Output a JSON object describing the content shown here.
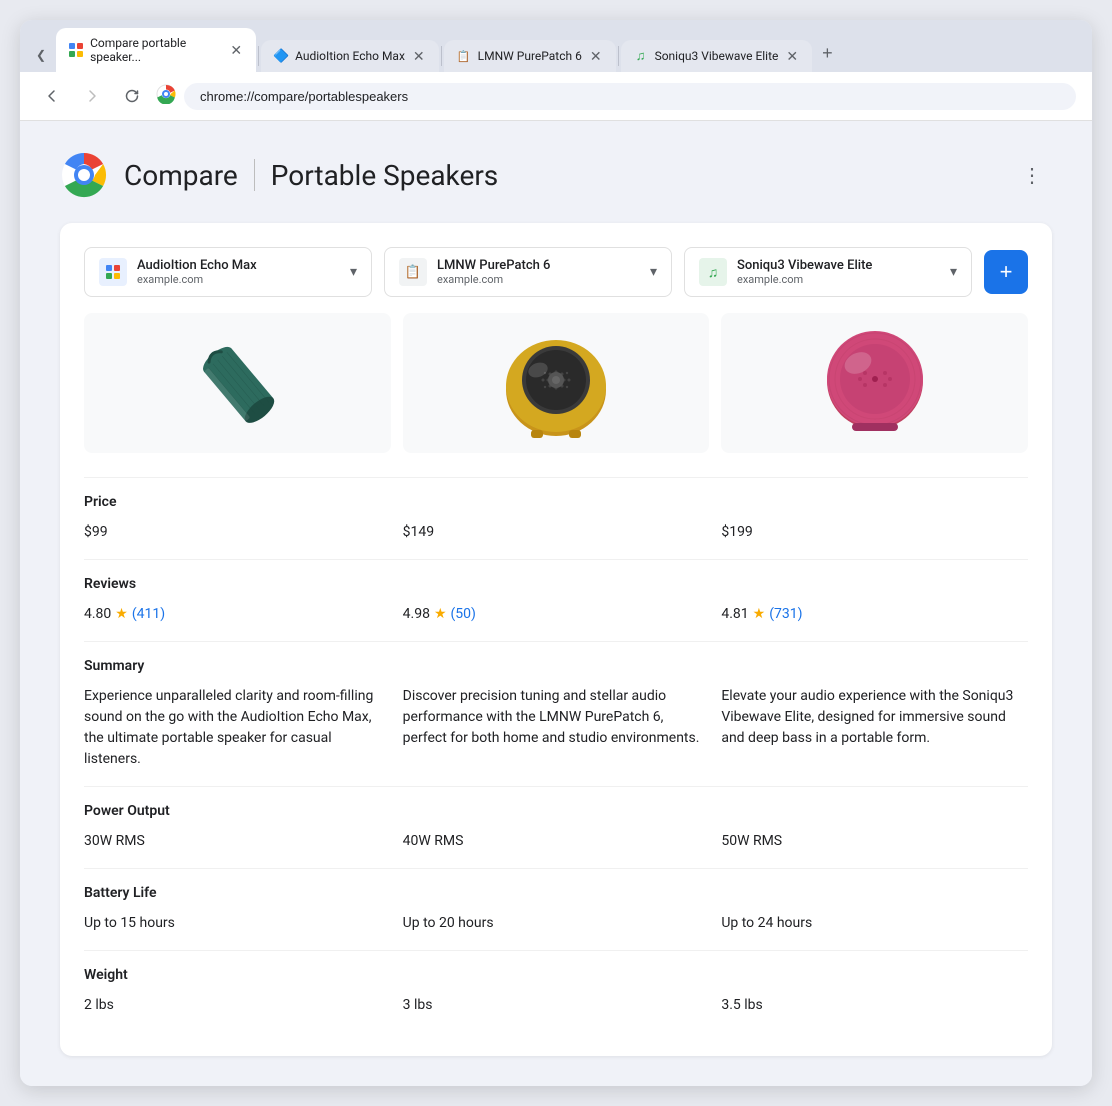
{
  "browser": {
    "tabs": [
      {
        "id": "tab-1",
        "label": "Compare portable speaker...",
        "url": "chrome://compare/portablespeakers",
        "active": true,
        "icon": "compare-icon",
        "icon_char": "⊞"
      },
      {
        "id": "tab-2",
        "label": "AudioItion Echo Max",
        "active": false,
        "icon": "audioition-icon",
        "icon_char": "🔷"
      },
      {
        "id": "tab-3",
        "label": "LMNW PurePatch 6",
        "active": false,
        "icon": "lmnw-icon",
        "icon_char": "📋"
      },
      {
        "id": "tab-4",
        "label": "Soniqu3 Vibewave Elite",
        "active": false,
        "icon": "soniqu3-icon",
        "icon_char": "♫"
      }
    ],
    "address": "chrome://compare/portablespeakers"
  },
  "page": {
    "brand": "Compare",
    "title": "Portable Speakers",
    "more_button_label": "⋮"
  },
  "products": [
    {
      "name": "AudioItion Echo Max",
      "domain": "example.com",
      "icon_color": "#4285F4",
      "icon_char": "🔷",
      "price": "$99",
      "rating": "4.80",
      "review_count": "411",
      "summary": "Experience unparalleled clarity and room-filling sound on the go with the AudioItion Echo Max, the ultimate portable speaker for casual listeners.",
      "power_output": "30W RMS",
      "battery_life": "Up to 15 hours",
      "weight": "2 lbs"
    },
    {
      "name": "LMNW PurePatch 6",
      "domain": "example.com",
      "icon_color": "#5f6368",
      "icon_char": "📋",
      "price": "$149",
      "rating": "4.98",
      "review_count": "50",
      "summary": "Discover precision tuning and stellar audio performance with the LMNW PurePatch 6, perfect for both home and studio environments.",
      "power_output": "40W RMS",
      "battery_life": "Up to 20 hours",
      "weight": "3 lbs"
    },
    {
      "name": "Soniqu3 Vibewave Elite",
      "domain": "example.com",
      "icon_color": "#34A853",
      "icon_char": "♫",
      "price": "$199",
      "rating": "4.81",
      "review_count": "731",
      "summary": "Elevate your audio experience with the Soniqu3 Vibewave Elite, designed for immersive sound and deep bass in a portable form.",
      "power_output": "50W RMS",
      "battery_life": "Up to 24 hours",
      "weight": "3.5 lbs"
    }
  ],
  "sections": [
    {
      "id": "price",
      "label": "Price",
      "field": "price"
    },
    {
      "id": "reviews",
      "label": "Reviews",
      "field": "rating"
    },
    {
      "id": "summary",
      "label": "Summary",
      "field": "summary"
    },
    {
      "id": "power_output",
      "label": "Power Output",
      "field": "power_output"
    },
    {
      "id": "battery_life",
      "label": "Battery Life",
      "field": "battery_life"
    },
    {
      "id": "weight",
      "label": "Weight",
      "field": "weight"
    }
  ],
  "add_product_label": "+",
  "back_disabled": false,
  "forward_disabled": true
}
